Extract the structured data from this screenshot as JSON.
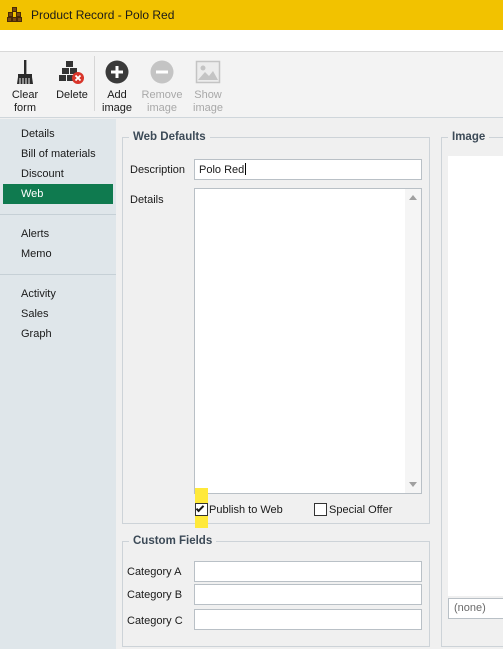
{
  "window": {
    "title": "Product Record - Polo Red"
  },
  "toolbar": {
    "clear_line1": "Clear",
    "clear_line2": "form",
    "delete_label": "Delete",
    "add_line1": "Add",
    "add_line2": "image",
    "remove_line1": "Remove",
    "remove_line2": "image",
    "show_line1": "Show",
    "show_line2": "image"
  },
  "sidebar": {
    "items": [
      {
        "label": "Details"
      },
      {
        "label": "Bill of materials"
      },
      {
        "label": "Discount"
      },
      {
        "label": "Web",
        "active": true
      },
      {
        "label": "Alerts"
      },
      {
        "label": "Memo"
      },
      {
        "label": "Activity"
      },
      {
        "label": "Sales"
      },
      {
        "label": "Graph"
      }
    ]
  },
  "web_defaults": {
    "legend": "Web Defaults",
    "description_label": "Description",
    "description_value": "Polo Red",
    "details_label": "Details",
    "details_value": "",
    "publish_label": "Publish to Web",
    "publish_checked": true,
    "special_label": "Special Offer",
    "special_checked": false
  },
  "custom_fields": {
    "legend": "Custom Fields",
    "fields": [
      {
        "label": "Category A",
        "value": ""
      },
      {
        "label": "Category B",
        "value": ""
      },
      {
        "label": "Category C",
        "value": ""
      }
    ]
  },
  "image": {
    "legend": "Image",
    "select_value": "(none)"
  },
  "colors": {
    "titlebar": "#f2c200",
    "active_nav": "#0f7a4f",
    "highlight": "#ffe93a"
  }
}
